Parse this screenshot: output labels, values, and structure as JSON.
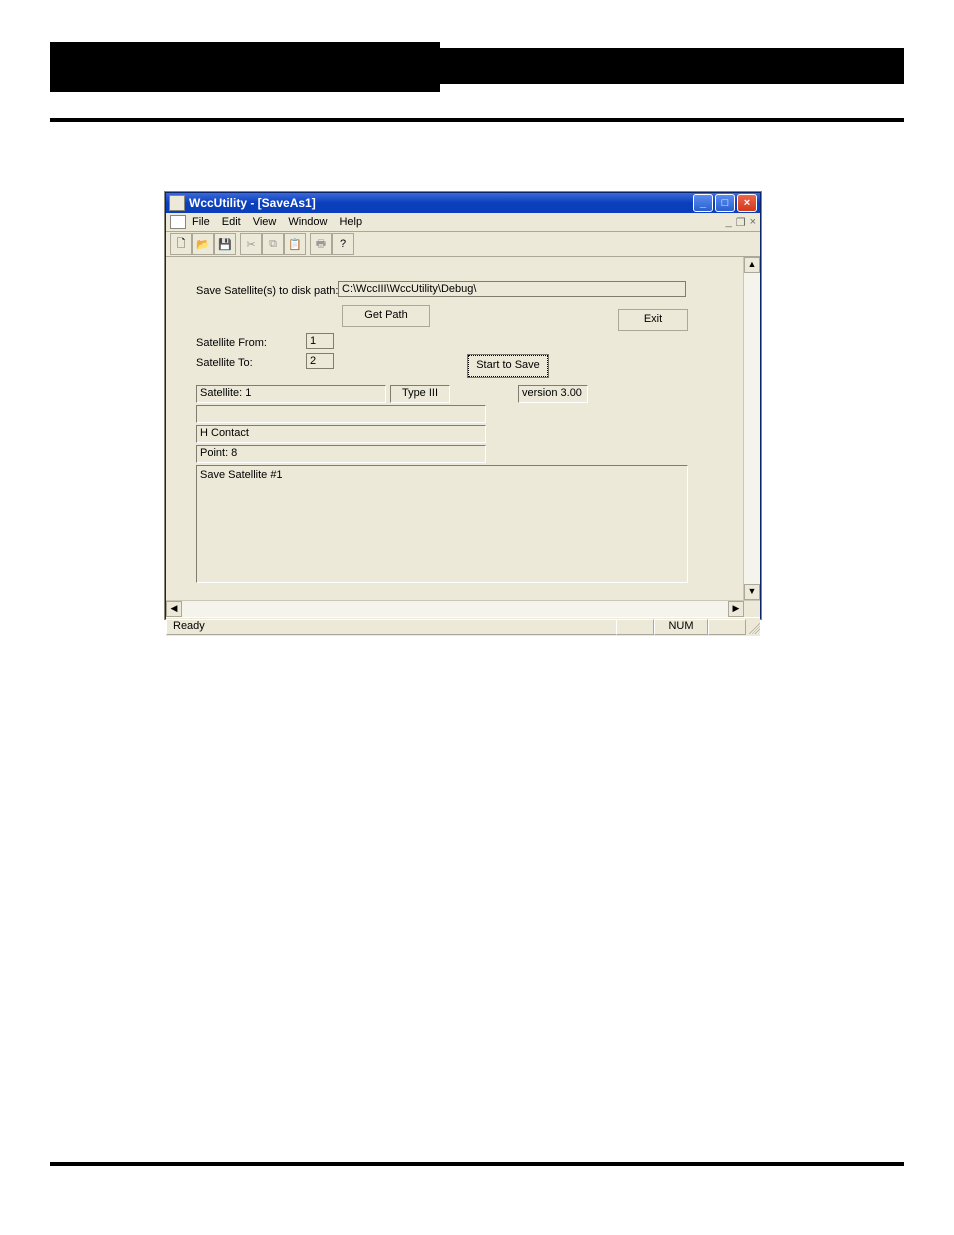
{
  "titlebar": {
    "text": "WccUtility - [SaveAs1]"
  },
  "menubar": {
    "items": [
      "File",
      "Edit",
      "View",
      "Window",
      "Help"
    ]
  },
  "toolbar": {
    "icons": [
      "new-icon",
      "open-icon",
      "save-icon",
      "cut-icon",
      "copy-icon",
      "paste-icon",
      "print-icon",
      "help-icon"
    ]
  },
  "form": {
    "save_path_label": "Save Satellite(s) to disk path:",
    "save_path_value": "C:\\WccIII\\WccUtility\\Debug\\",
    "get_path_label": "Get Path",
    "exit_label": "Exit",
    "sat_from_label": "Satellite From:",
    "sat_from_value": "1",
    "sat_to_label": "Satellite To:",
    "sat_to_value": "2",
    "start_save_label": "Start to Save",
    "satellite_status": "Satellite: 1",
    "type_status": "Type III",
    "version_status": "version 3.00",
    "contact_status": "H Contact",
    "point_status": "Point: 8",
    "log_text": "Save Satellite #1"
  },
  "statusbar": {
    "ready": "Ready",
    "num": "NUM"
  }
}
